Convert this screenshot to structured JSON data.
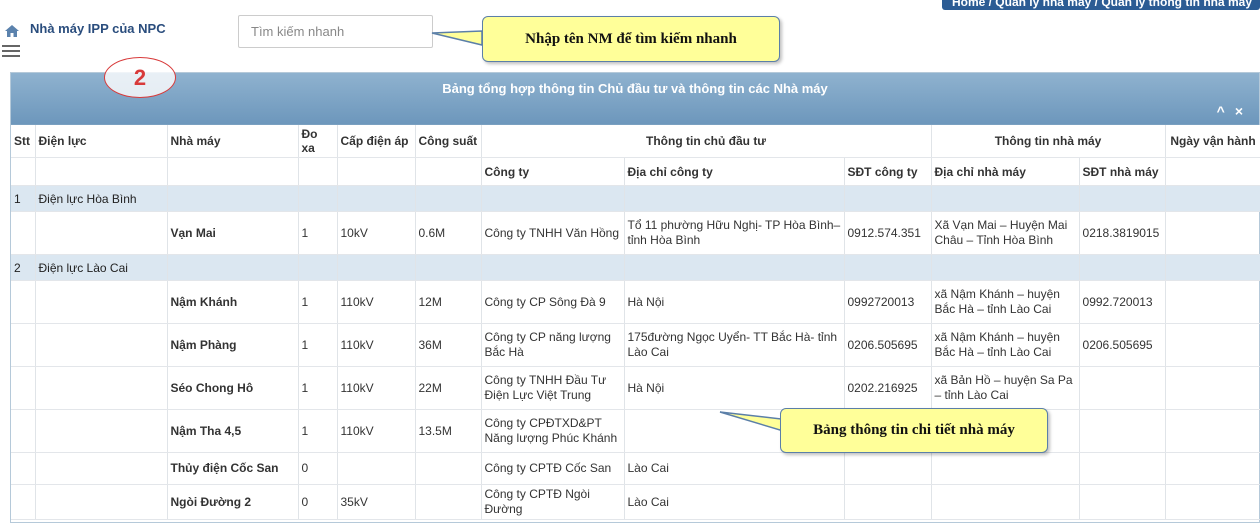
{
  "breadcrumb": "  Home  /  Quản lý nhà máy  /  Quản lý thông tin nhà máy",
  "page_title": "Nhà máy IPP của NPC",
  "search": {
    "placeholder": "Tìm kiếm nhanh"
  },
  "annotations": {
    "callout_search": "Nhập tên NM để tìm kiếm nhanh",
    "callout_table": "Bảng thông tin chi tiết nhà máy",
    "step_number": "2"
  },
  "panel": {
    "title": "Bảng tổng hợp thông tin Chủ đầu tư và thông tin các Nhà máy",
    "collapse_icon": "^",
    "close_icon": "×"
  },
  "table": {
    "headers": {
      "stt": "Stt",
      "dien_luc": "Điện lực",
      "nha_may": "Nhà máy",
      "do_xa": "Đo xa",
      "cap_dien_ap": "Cấp điện áp",
      "cong_suat": "Công suất",
      "chu_dau_tu": "Thông tin chủ đầu tư",
      "thong_tin_nm": "Thông tin nhà máy",
      "ngay_van_hanh": "Ngày vận hành",
      "cong_ty": "Công ty",
      "dia_chi_cong_ty": "Địa chỉ công ty",
      "sdt_cong_ty": "SĐT công ty",
      "dia_chi_nm": "Địa chỉ nhà máy",
      "sdt_nm": "SĐT nhà máy"
    },
    "groups": [
      {
        "stt": "1",
        "name": "Điện lực Hòa Bình",
        "rows": [
          {
            "plant": "Vạn Mai",
            "do_xa": "1",
            "voltage": "10kV",
            "capacity": "0.6M",
            "company": "Công ty TNHH Văn Hồng",
            "company_address": "Tổ 11 phường Hữu Nghị- TP Hòa Bình– tỉnh Hòa Bình",
            "company_phone": "0912.574.351",
            "plant_address": "Xã Vạn Mai – Huyện Mai Châu – Tỉnh Hòa Bình",
            "plant_phone": "0218.3819015"
          }
        ]
      },
      {
        "stt": "2",
        "name": "Điện lực Lào Cai",
        "rows": [
          {
            "plant": "Nậm Khánh",
            "do_xa": "1",
            "voltage": "110kV",
            "capacity": "12M",
            "company": "Công ty CP Sông Đà 9",
            "company_address": "Hà Nội",
            "company_phone": "0992720013",
            "plant_address": "xã Nậm Khánh – huyện Bắc Hà – tỉnh Lào Cai",
            "plant_phone": "0992.720013"
          },
          {
            "plant": "Nậm Phàng",
            "do_xa": "1",
            "voltage": "110kV",
            "capacity": "36M",
            "company": "Công ty CP năng lượng Bắc Hà",
            "company_address": "175đường Ngọc Uyển- TT Bắc Hà- tỉnh Lào Cai",
            "company_phone": "0206.505695",
            "plant_address": "xã Nậm Khánh – huyện Bắc Hà – tỉnh Lào Cai",
            "plant_phone": "0206.505695"
          },
          {
            "plant": "Séo Chong Hô",
            "do_xa": "1",
            "voltage": "110kV",
            "capacity": "22M",
            "company": "Công ty TNHH Đầu Tư Điện Lực Việt Trung",
            "company_address": "Hà Nội",
            "company_phone": "0202.216925",
            "plant_address": "xã Bản Hồ – huyện Sa Pa – tỉnh Lào Cai",
            "plant_phone": ""
          },
          {
            "plant": "Nậm Tha 4,5",
            "do_xa": "1",
            "voltage": "110kV",
            "capacity": "13.5M",
            "company": "Công ty CPĐTXD&PT Năng lượng Phúc Khánh",
            "company_address": "",
            "company_phone": "",
            "plant_address": "",
            "plant_phone": ""
          },
          {
            "plant": "Thủy điện Cốc San",
            "do_xa": "0",
            "voltage": "",
            "capacity": "",
            "company": "Công ty CPTĐ Cốc San",
            "company_address": "Lào Cai",
            "company_phone": "",
            "plant_address": "",
            "plant_phone": ""
          },
          {
            "plant": "Ngòi Đường 2",
            "do_xa": "0",
            "voltage": "35kV",
            "capacity": "",
            "company": "Công ty CPTĐ Ngòi Đường",
            "company_address": "Lào Cai",
            "company_phone": "",
            "plant_address": "",
            "plant_phone": ""
          }
        ]
      }
    ]
  },
  "colors": {
    "panel_header": "#7ba3c6",
    "group_row": "#dbe7f1",
    "callout_fill": "#ffff99",
    "step_circle": "#d83a3a"
  }
}
